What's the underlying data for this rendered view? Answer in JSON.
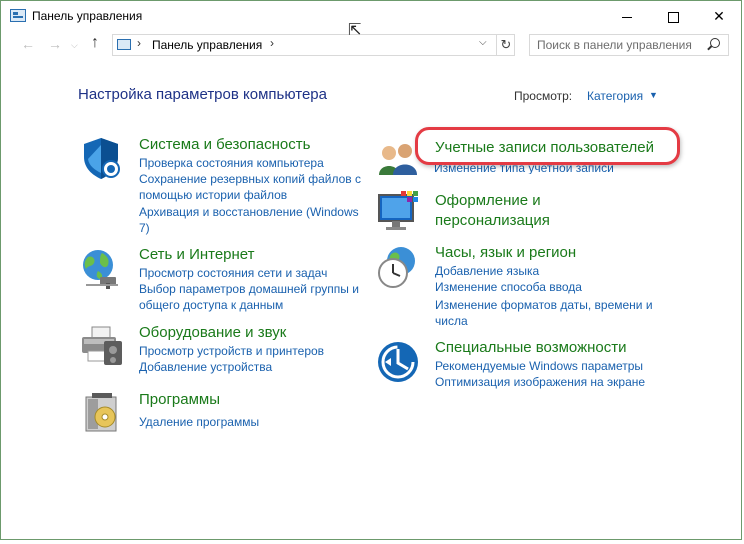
{
  "window": {
    "title": "Панель управления",
    "minimize": "—",
    "maximize": "☐",
    "close": "✕"
  },
  "navbar": {
    "back": "←",
    "forward": "→",
    "up": "↑",
    "breadcrumb_sep": "›",
    "address": "Панель управления",
    "dropdown": "⌵",
    "refresh": "↻",
    "search_placeholder": "Поиск в панели управления"
  },
  "header": {
    "title": "Настройка параметров компьютера",
    "view_label": "Просмотр:",
    "view_value": "Категория",
    "view_caret": "▼"
  },
  "categories": {
    "system": {
      "title": "Система и безопасность",
      "links": [
        "Проверка состояния компьютера",
        "Сохранение резервных копий файлов с помощью истории файлов",
        "Архивация и восстановление (Windows 7)"
      ]
    },
    "network": {
      "title": "Сеть и Интернет",
      "links": [
        "Просмотр состояния сети и задач",
        "Выбор параметров домашней группы и общего доступа к данным"
      ]
    },
    "hardware": {
      "title": "Оборудование и звук",
      "links": [
        "Просмотр устройств и принтеров",
        "Добавление устройства"
      ]
    },
    "programs": {
      "title": "Программы",
      "links": [
        "Удаление программы"
      ]
    },
    "users": {
      "title": "Учетные записи пользователей",
      "links": []
    },
    "appearance": {
      "title": "Оформление и персонализация",
      "links": []
    },
    "clock": {
      "title": "Часы, язык и регион",
      "links": [
        "Добавление языка",
        "Изменение способа ввода",
        "Изменение форматов даты, времени и числа"
      ]
    },
    "access": {
      "title": "Специальные возможности",
      "links": [
        "Рекомендуемые Windows параметры",
        "Оптимизация изображения на экране"
      ]
    }
  },
  "colors": {
    "category_title": "#1a7a1a",
    "link": "#1a61ae",
    "heading": "#1e3287",
    "highlight_ring": "#e43b44"
  }
}
